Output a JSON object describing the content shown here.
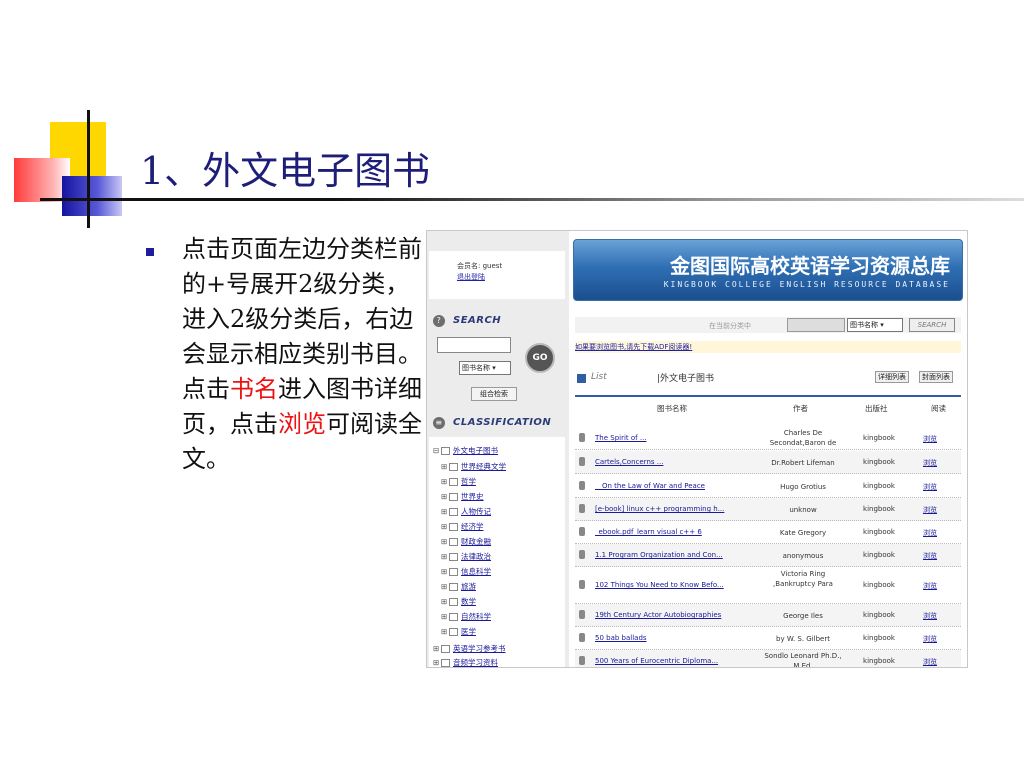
{
  "slide": {
    "title": "1、外文电子图书",
    "bullet_part1": "点击页面左边分类栏前的+号展开2级分类，进入2级分类后，右边会显示相应类别书目。点击",
    "bullet_red1": "书名",
    "bullet_part2": "进入图书详细页，点击",
    "bullet_red2": "浏览",
    "bullet_part3": "可阅读全文。"
  },
  "user": {
    "member_label": "会员名: guest",
    "logout": "退出登陆"
  },
  "banner": {
    "title_cn": "金图国际高校英语学习资源总库",
    "title_en": "KINGBOOK COLLEGE ENGLISH RESOURCE DATABASE"
  },
  "left_search": {
    "heading": "SEARCH",
    "select_value": "图书名称",
    "go_label": "GO",
    "combo_label": "组合检索"
  },
  "classification": {
    "heading": "CLASSIFICATION",
    "items": [
      "外文电子图书",
      "世界经典文学",
      "哲学",
      "世界史",
      "人物传记",
      "经济学",
      "财政金融",
      "法律政治",
      "信息科学",
      "旅游",
      "数学",
      "自然科学",
      "医学",
      "英语学习参考书",
      "音频学习资料"
    ]
  },
  "top_search": {
    "hint": "在当前分类中",
    "select_value": "图书名称",
    "button": "SEARCH"
  },
  "pdf_note": "如果要浏览图书,请先下载ADF阅读器!",
  "list": {
    "title": "List",
    "current_category": "|外文电子图书",
    "view_detail": "详细列表",
    "view_cover": "封面列表",
    "headers": {
      "name": "图书名称",
      "author": "作者",
      "publisher": "出版社",
      "read": "阅读"
    },
    "rows": [
      {
        "title": "The Spirit of ...",
        "author": "Charles De Secondat,Baron de",
        "publisher": "kingbook",
        "read": "浏览"
      },
      {
        "title": "Cartels,Concerns ...",
        "author": "Dr.Robert Lifeman",
        "publisher": "kingbook",
        "read": "浏览"
      },
      {
        "title": "__On the Law of War and Peace",
        "author": "Hugo Grotius",
        "publisher": "kingbook",
        "read": "浏览"
      },
      {
        "title": "[e-book] linux c++ programming h...",
        "author": "unknow",
        "publisher": "kingbook",
        "read": "浏览"
      },
      {
        "title": "_ebook.pdf_learn visual c++ 6",
        "author": "Kate Gregory",
        "publisher": "kingbook",
        "read": "浏览"
      },
      {
        "title": "1.1 Program Organization and Con...",
        "author": "anonymous",
        "publisher": "kingbook",
        "read": "浏览"
      },
      {
        "title": "102 Things You Need to Know Befo...",
        "author": "Victoria Ring ,Bankruptcy Para",
        "publisher": "kingbook",
        "read": "浏览"
      },
      {
        "title": "19th Century Actor Autobiographies",
        "author": "George Iles",
        "publisher": "kingbook",
        "read": "浏览"
      },
      {
        "title": "50 bab ballads",
        "author": "by W. S. Gilbert",
        "publisher": "kingbook",
        "read": "浏览"
      },
      {
        "title": "500 Years of Eurocentric Diploma...",
        "author": "Sondlo Leonard Ph.D., M.Ed.",
        "publisher": "kingbook",
        "read": "浏览"
      }
    ]
  }
}
